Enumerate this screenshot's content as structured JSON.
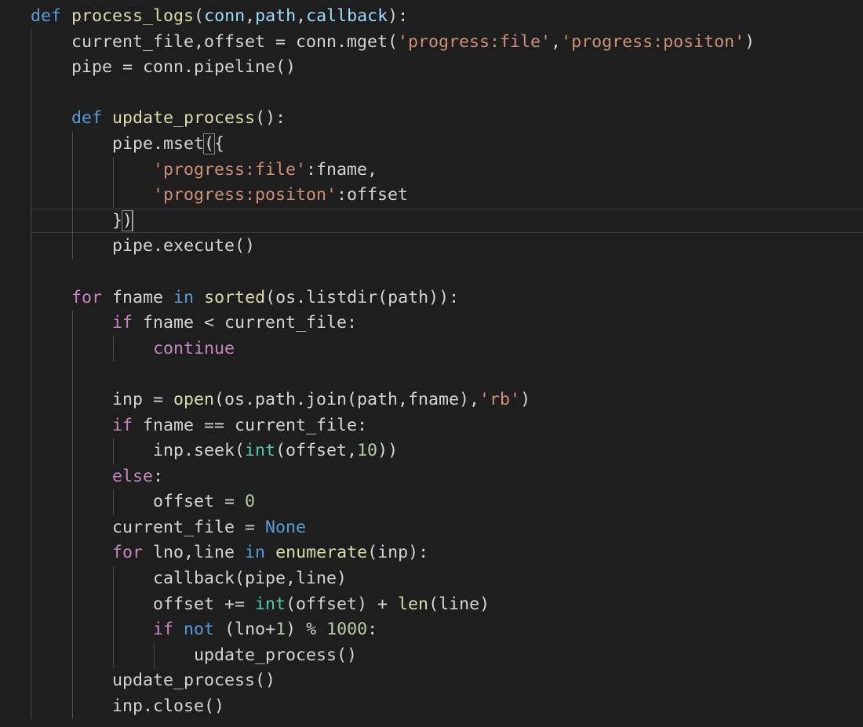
{
  "editor": {
    "language": "python",
    "theme": {
      "background": "#1e1e1e",
      "keyword": "#569cd6",
      "control": "#c586c0",
      "function": "#dcdcaa",
      "string": "#ce9178",
      "number": "#b5cea8",
      "builtin": "#4ec9b0",
      "parameter": "#9cdcfe",
      "text": "#d4d4d4"
    },
    "cursor_line": 9,
    "lines": [
      [
        [
          "kw",
          "def"
        ],
        [
          "t",
          " "
        ],
        [
          "fn",
          "process_logs"
        ],
        [
          "t",
          "("
        ],
        [
          "par",
          "conn"
        ],
        [
          "t",
          ","
        ],
        [
          "par",
          "path"
        ],
        [
          "t",
          ","
        ],
        [
          "par",
          "callback"
        ],
        [
          "t",
          "):"
        ]
      ],
      [
        [
          "t",
          "    current_file,offset = conn.mget("
        ],
        [
          "str",
          "'progress:file'"
        ],
        [
          "t",
          ","
        ],
        [
          "str",
          "'progress:positon'"
        ],
        [
          "t",
          ")"
        ]
      ],
      [
        [
          "t",
          "    pipe = conn.pipeline()"
        ]
      ],
      [],
      [
        [
          "t",
          "    "
        ],
        [
          "kw",
          "def"
        ],
        [
          "t",
          " "
        ],
        [
          "fn",
          "update_process"
        ],
        [
          "t",
          "():"
        ]
      ],
      [
        [
          "t",
          "        pipe.mset"
        ],
        [
          "box",
          "("
        ],
        [
          "t",
          "{"
        ]
      ],
      [
        [
          "t",
          "            "
        ],
        [
          "str",
          "'progress:file'"
        ],
        [
          "t",
          ":fname,"
        ]
      ],
      [
        [
          "t",
          "            "
        ],
        [
          "str",
          "'progress:positon'"
        ],
        [
          "t",
          ":offset"
        ]
      ],
      [
        [
          "t",
          "        }"
        ],
        [
          "box",
          ")"
        ]
      ],
      [
        [
          "t",
          "        pipe.execute()"
        ]
      ],
      [],
      [
        [
          "t",
          "    "
        ],
        [
          "ctl",
          "for"
        ],
        [
          "t",
          " fname "
        ],
        [
          "kw",
          "in"
        ],
        [
          "t",
          " "
        ],
        [
          "fn",
          "sorted"
        ],
        [
          "t",
          "(os.listdir(path)):"
        ]
      ],
      [
        [
          "t",
          "        "
        ],
        [
          "ctl",
          "if"
        ],
        [
          "t",
          " fname < current_file:"
        ]
      ],
      [
        [
          "t",
          "            "
        ],
        [
          "ctl",
          "continue"
        ]
      ],
      [],
      [
        [
          "t",
          "        inp = "
        ],
        [
          "fn",
          "open"
        ],
        [
          "t",
          "(os.path.join(path,fname),"
        ],
        [
          "str",
          "'rb'"
        ],
        [
          "t",
          ")"
        ]
      ],
      [
        [
          "t",
          "        "
        ],
        [
          "ctl",
          "if"
        ],
        [
          "t",
          " fname == current_file:"
        ]
      ],
      [
        [
          "t",
          "            inp.seek("
        ],
        [
          "bi",
          "int"
        ],
        [
          "t",
          "(offset,"
        ],
        [
          "num",
          "10"
        ],
        [
          "t",
          "))"
        ]
      ],
      [
        [
          "t",
          "        "
        ],
        [
          "ctl",
          "else"
        ],
        [
          "t",
          ":"
        ]
      ],
      [
        [
          "t",
          "            offset = "
        ],
        [
          "num",
          "0"
        ]
      ],
      [
        [
          "t",
          "        current_file = "
        ],
        [
          "kw",
          "None"
        ]
      ],
      [
        [
          "t",
          "        "
        ],
        [
          "ctl",
          "for"
        ],
        [
          "t",
          " lno,line "
        ],
        [
          "kw",
          "in"
        ],
        [
          "t",
          " "
        ],
        [
          "fn",
          "enumerate"
        ],
        [
          "t",
          "(inp):"
        ]
      ],
      [
        [
          "t",
          "            callback(pipe,line)"
        ]
      ],
      [
        [
          "t",
          "            offset += "
        ],
        [
          "bi",
          "int"
        ],
        [
          "t",
          "(offset) + "
        ],
        [
          "fn",
          "len"
        ],
        [
          "t",
          "(line)"
        ]
      ],
      [
        [
          "t",
          "            "
        ],
        [
          "ctl",
          "if"
        ],
        [
          "t",
          " "
        ],
        [
          "kw",
          "not"
        ],
        [
          "t",
          " (lno+"
        ],
        [
          "num",
          "1"
        ],
        [
          "t",
          ") % "
        ],
        [
          "num",
          "1000"
        ],
        [
          "t",
          ":"
        ]
      ],
      [
        [
          "t",
          "                update_process()"
        ]
      ],
      [
        [
          "t",
          "        update_process()"
        ]
      ],
      [
        [
          "t",
          "        inp.close()"
        ]
      ]
    ]
  }
}
